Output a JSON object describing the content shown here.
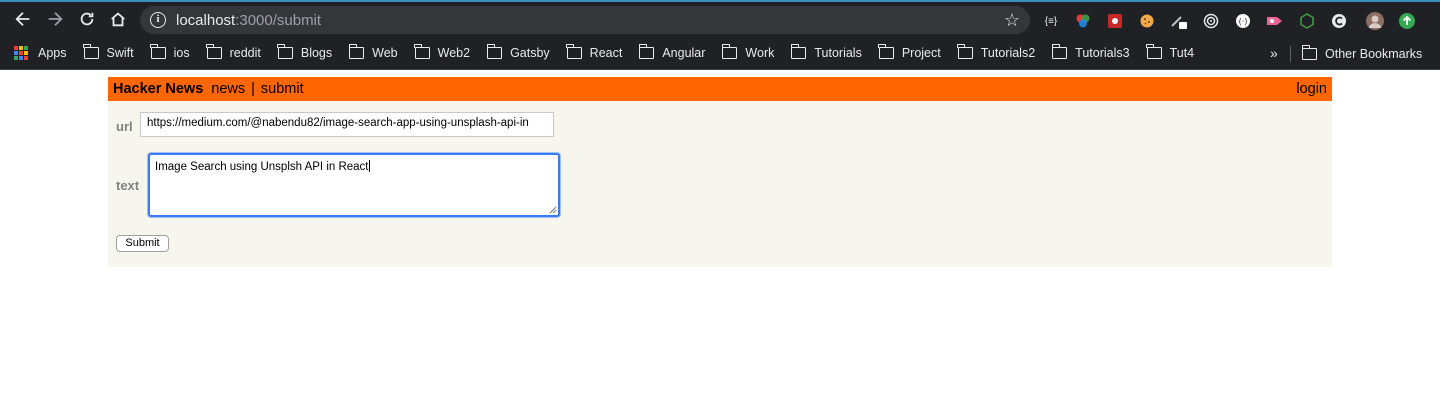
{
  "browser": {
    "url_host": "localhost",
    "url_path": ":3000/submit",
    "extensions": [
      "{≡}",
      "color-wheel-icon",
      "ext-red-icon",
      "cookie-icon",
      "pen-icon",
      "target-icon",
      "(·)",
      "ext-pink-icon",
      "node-icon",
      "C",
      "avatar-icon",
      "update-icon"
    ]
  },
  "bookmarks": {
    "apps_label": "Apps",
    "items": [
      "Swift",
      "ios",
      "reddit",
      "Blogs",
      "Web",
      "Web2",
      "Gatsby",
      "React",
      "Angular",
      "Work",
      "Tutorials",
      "Project",
      "Tutorials2",
      "Tutorials3",
      "Tut4"
    ],
    "more": "»",
    "other": "Other Bookmarks"
  },
  "hn": {
    "brand": "Hacker News",
    "nav_news": "news",
    "nav_sep": "|",
    "nav_submit": "submit",
    "login": "login",
    "colors": {
      "header": "#ff6600",
      "background": "#f6f6ef",
      "label": "#828282"
    }
  },
  "form": {
    "url_label": "url",
    "url_value": "https://medium.com/@nabendu82/image-search-app-using-unsplash-api-in",
    "text_label": "text",
    "text_value": "Image Search using Unsplsh API in React",
    "submit_label": "Submit"
  }
}
